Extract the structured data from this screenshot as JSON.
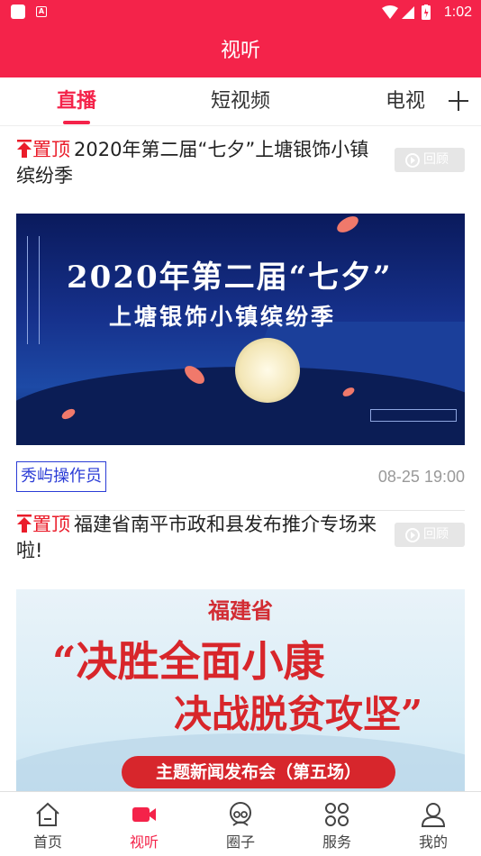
{
  "status_bar": {
    "time": "1:02"
  },
  "header": {
    "title": "视听"
  },
  "tabs": [
    {
      "label": "直播",
      "active": true
    },
    {
      "label": "短视频",
      "active": false
    },
    {
      "label": "电视",
      "active": false
    }
  ],
  "feed": [
    {
      "pin_label": "置顶",
      "title": "2020年第二届“七夕”上塘银饰小镇缤纷季",
      "replay_label": "回顾",
      "banner_line1": "2020年第二届“七夕”",
      "banner_line2": "上塘银饰小镇缤纷季",
      "author": "秀屿操作员",
      "time": "08-25 19:00"
    },
    {
      "pin_label": "置顶",
      "title": "福建省南平市政和县发布推介专场来啦!",
      "replay_label": "回顾",
      "banner_top": "福建省",
      "banner_line1": "“决胜全面小康",
      "banner_line2": "决战脱贫攻坚”",
      "banner_pill": "主题新闻发布会（第五场）"
    }
  ],
  "bottom_nav": [
    {
      "label": "首页",
      "icon": "home-icon",
      "active": false
    },
    {
      "label": "视听",
      "icon": "video-camera-icon",
      "active": true
    },
    {
      "label": "圈子",
      "icon": "circle-icon",
      "active": false
    },
    {
      "label": "服务",
      "icon": "grid-icon",
      "active": false
    },
    {
      "label": "我的",
      "icon": "user-icon",
      "active": false
    }
  ],
  "colors": {
    "brand": "#f4234a",
    "pin": "#ea1c2a",
    "author": "#2b3cd6"
  }
}
